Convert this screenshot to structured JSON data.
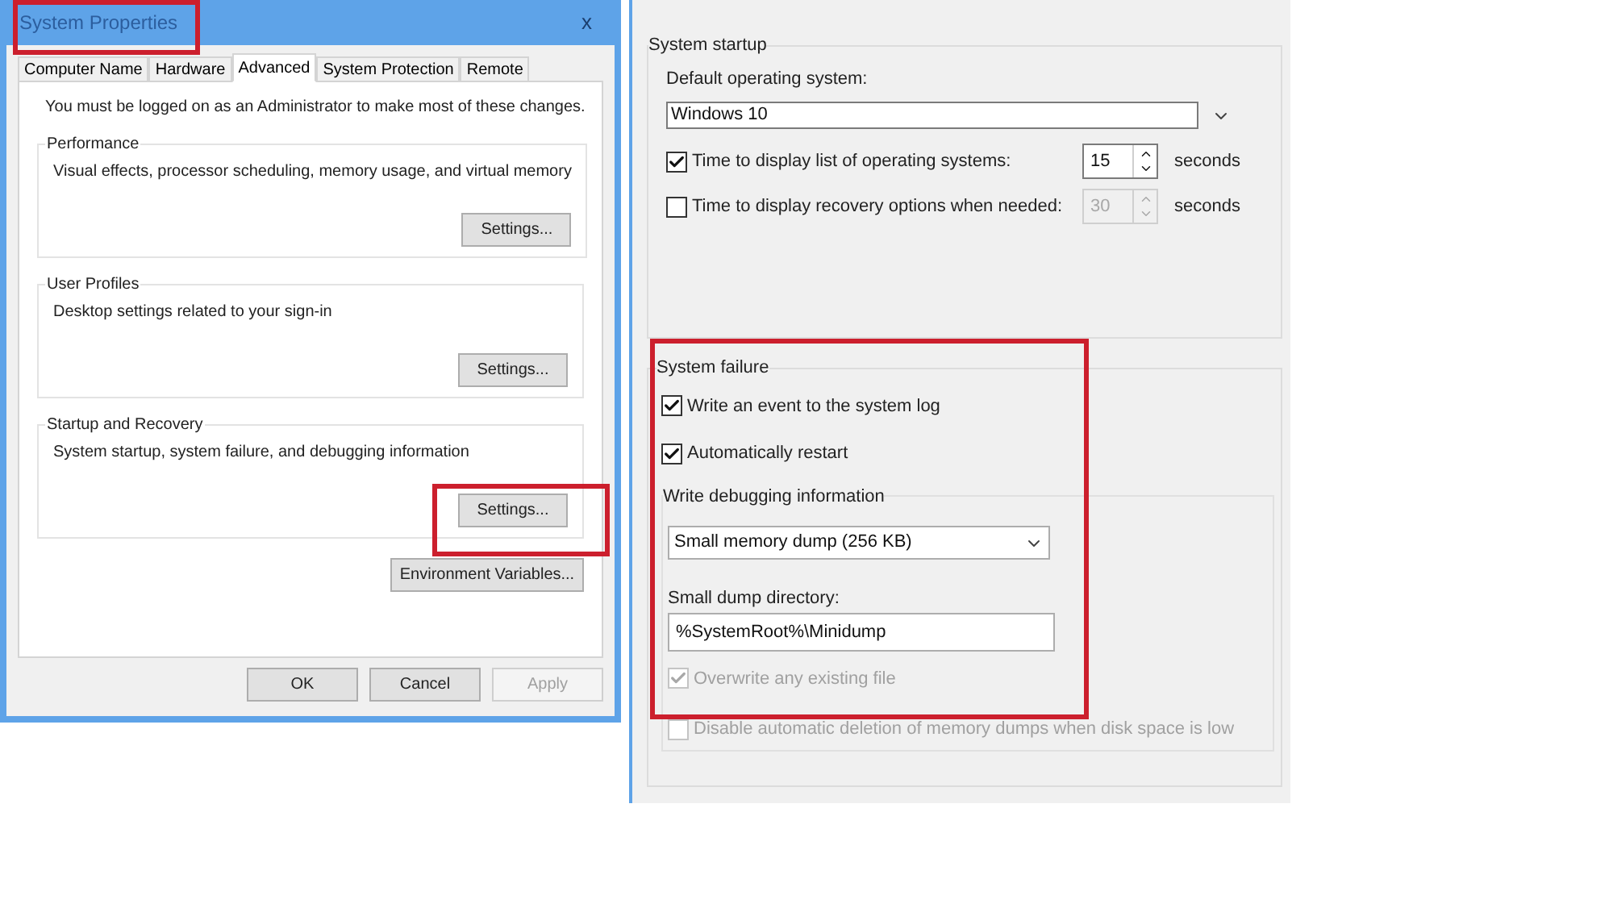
{
  "system_properties": {
    "title": "System Properties",
    "close": "x",
    "tabs": [
      {
        "label": "Computer Name",
        "selected": false
      },
      {
        "label": "Hardware",
        "selected": false
      },
      {
        "label": "Advanced",
        "selected": true
      },
      {
        "label": "System Protection",
        "selected": false
      },
      {
        "label": "Remote",
        "selected": false
      }
    ],
    "notice": "You must be logged on as an Administrator to make most of these changes.",
    "groups": [
      {
        "title": "Performance",
        "description": "Visual effects, processor scheduling, memory usage, and virtual memory",
        "button": "Settings..."
      },
      {
        "title": "User Profiles",
        "description": "Desktop settings related to your sign-in",
        "button": "Settings..."
      },
      {
        "title": "Startup and Recovery",
        "description": "System startup, system failure, and debugging information",
        "button": "Settings..."
      }
    ],
    "environment_button": "Environment Variables...",
    "buttons": [
      {
        "label": "OK",
        "disabled": false
      },
      {
        "label": "Cancel",
        "disabled": false
      },
      {
        "label": "Apply",
        "disabled": true
      }
    ]
  },
  "startup_and_recovery": {
    "system_startup": {
      "title": "System startup",
      "default_os_label": "Default operating system:",
      "default_os": "Windows 10",
      "timers": [
        {
          "label": "Time to display list of operating systems:",
          "checked": true,
          "value": "15",
          "unit": "seconds",
          "disabled": false
        },
        {
          "label": "Time to display recovery options when needed:",
          "checked": false,
          "value": "30",
          "unit": "seconds",
          "disabled": true
        }
      ]
    },
    "system_failure": {
      "title": "System failure",
      "options": [
        {
          "label": "Write an event to the system log",
          "checked": true,
          "disabled": false
        },
        {
          "label": "Automatically restart",
          "checked": true,
          "disabled": false
        }
      ],
      "debug_title": "Write debugging information",
      "debug_type": "Small memory dump (256 KB)",
      "dir_label": "Small dump directory:",
      "dir_value": "%SystemRoot%\\Minidump",
      "debug_options": [
        {
          "label": "Overwrite any existing file",
          "checked": true,
          "disabled": true
        },
        {
          "label": "Disable automatic deletion of memory dumps when disk space is low",
          "checked": false,
          "disabled": true
        }
      ]
    }
  }
}
